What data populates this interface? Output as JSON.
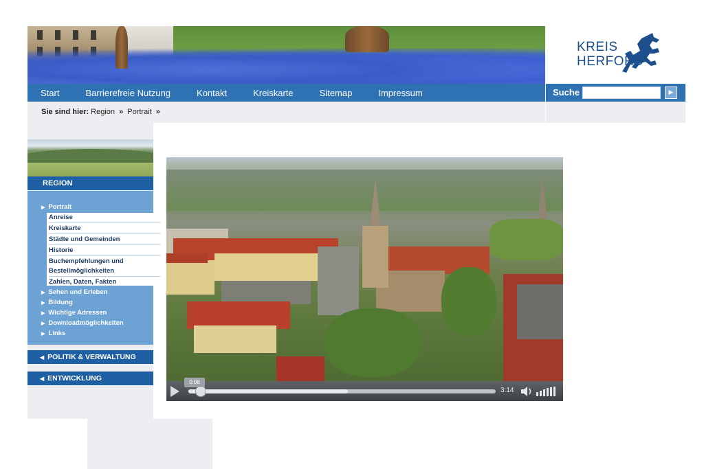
{
  "logo": {
    "line1": "KREIS",
    "line2": "HERFORD",
    "color": "#1d4f8c"
  },
  "nav": {
    "items": [
      "Start",
      "Barrierefreie Nutzung",
      "Kontakt",
      "Kreiskarte",
      "Sitemap",
      "Impressum"
    ],
    "bg_color": "#2f72b4"
  },
  "search": {
    "label": "Suche",
    "value": "",
    "button_icon": "arrow-right-icon"
  },
  "breadcrumb": {
    "label": "Sie sind hier:",
    "items": [
      "Region",
      "Portrait"
    ],
    "separator": "»"
  },
  "sidebar": {
    "region_title": "REGION",
    "menu": {
      "active": "Portrait",
      "sub_items": [
        "Anreise",
        "Kreiskarte",
        "Städte und Gemeinden",
        "Historie",
        "Buchempfehlungen und Bestellmöglichkeiten",
        "Zahlen, Daten, Fakten"
      ],
      "more_items": [
        "Sehen und Erleben",
        "Bildung",
        "Wichtige Adressen",
        "Downloadmöglichkeiten",
        "Links"
      ]
    },
    "sections": [
      "POLITIK & VERWALTUNG",
      "ENTWICKLUNG"
    ]
  },
  "video": {
    "current_time": "0:08",
    "duration": "3:14",
    "progress": 0.04,
    "buffered": 0.52
  }
}
